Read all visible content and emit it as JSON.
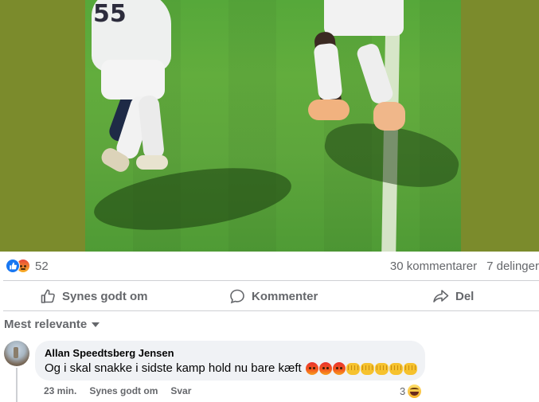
{
  "post": {
    "reactions": {
      "icons": [
        "like-icon",
        "angry-icon"
      ],
      "count": "52"
    },
    "comments_count": "30 kommentarer",
    "shares_count": "7 delinger",
    "jersey_number": "55"
  },
  "actions": {
    "like_label": "Synes godt om",
    "comment_label": "Kommenter",
    "share_label": "Del"
  },
  "sort": {
    "label": "Mest relevante"
  },
  "comments": [
    {
      "author": "Allan Speedtsberg Jensen",
      "text": "Og i skal snakke i sidste kamp hold nu bare kæft",
      "emojis": [
        "angry-face",
        "angry-face",
        "angry-face",
        "fist",
        "fist",
        "fist",
        "fist",
        "fist"
      ],
      "time": "23 min.",
      "like_label": "Synes godt om",
      "reply_label": "Svar",
      "reaction_count": "3",
      "reaction_icon": "laughing-face"
    }
  ],
  "colors": {
    "page_background": "#ffffff",
    "media_background": "#7b8b2c",
    "pitch_green": "#5ea63c",
    "secondary_text": "#65676b",
    "like_blue": "#1877f2",
    "bubble_background": "#f0f2f5",
    "divider": "#ced0d4"
  }
}
